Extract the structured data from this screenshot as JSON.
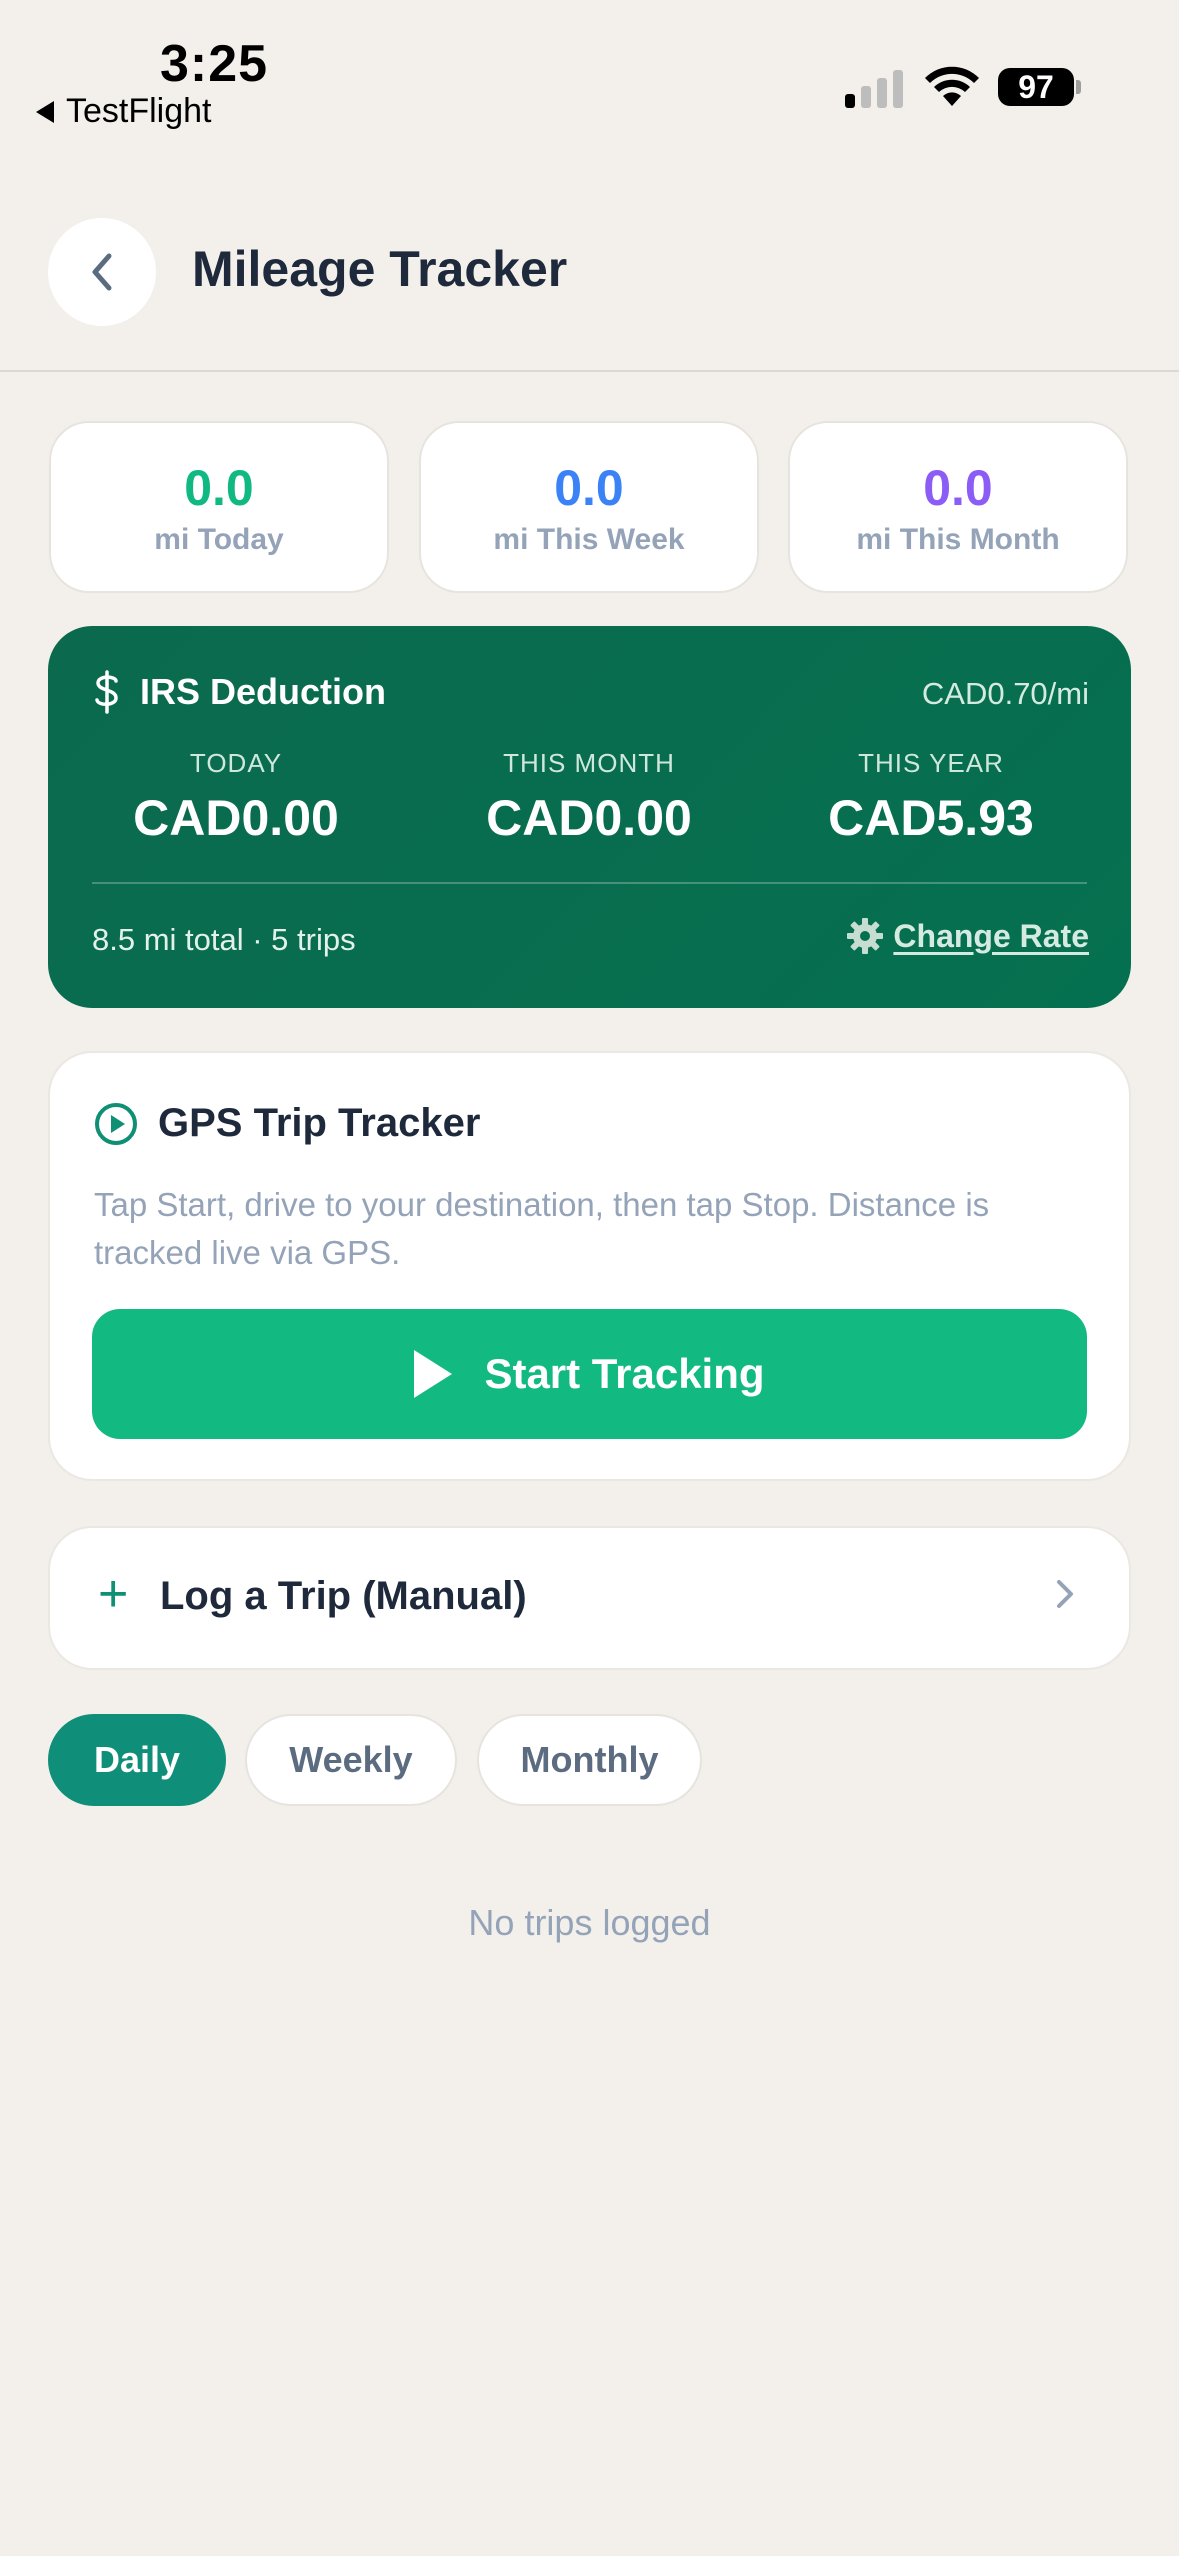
{
  "status_bar": {
    "time": "3:25",
    "back_app": "TestFlight",
    "battery": "97"
  },
  "header": {
    "title": "Mileage Tracker"
  },
  "stats": [
    {
      "value": "0.0",
      "label": "mi Today",
      "color": "#10b981"
    },
    {
      "value": "0.0",
      "label": "mi This Week",
      "color": "#3b82f6"
    },
    {
      "value": "0.0",
      "label": "mi This Month",
      "color": "#8b5cf6"
    }
  ],
  "irs": {
    "title": "IRS Deduction",
    "rate": "CAD0.70/mi",
    "columns": [
      {
        "label": "TODAY",
        "amount": "CAD0.00"
      },
      {
        "label": "THIS MONTH",
        "amount": "CAD0.00"
      },
      {
        "label": "THIS YEAR",
        "amount": "CAD5.93"
      }
    ],
    "summary": "8.5 mi total · 5 trips",
    "change_rate": "Change Rate"
  },
  "gps": {
    "title": "GPS Trip Tracker",
    "description": "Tap Start, drive to your destination, then tap Stop. Distance is tracked live via GPS.",
    "button": "Start Tracking"
  },
  "manual": {
    "plus": "+",
    "label": "Log a Trip (Manual)"
  },
  "tabs": [
    {
      "label": "Daily",
      "active": true
    },
    {
      "label": "Weekly",
      "active": false
    },
    {
      "label": "Monthly",
      "active": false
    }
  ],
  "empty_state": "No trips logged"
}
